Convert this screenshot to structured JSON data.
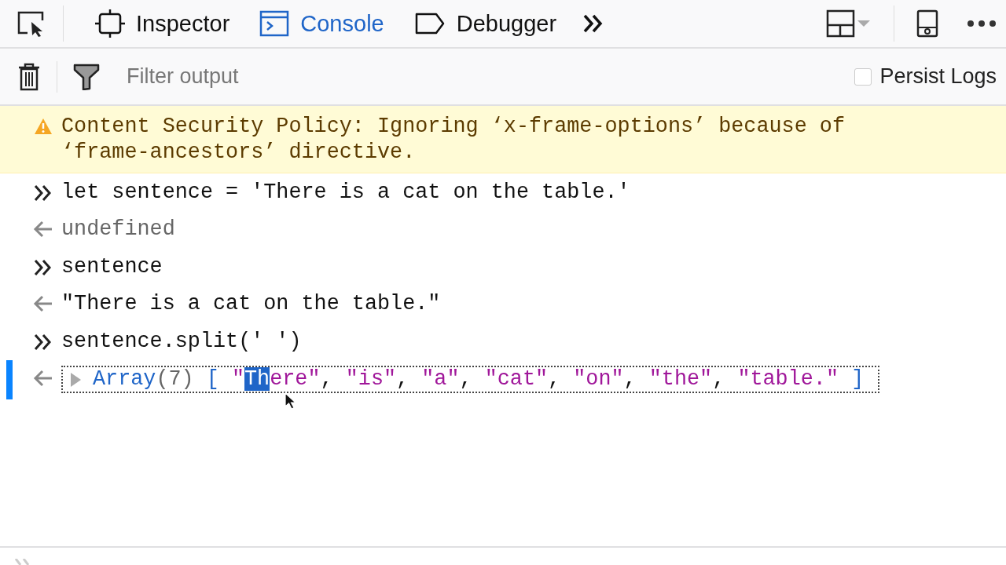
{
  "toolbar": {
    "tabs": [
      {
        "label": "Inspector",
        "selected": false
      },
      {
        "label": "Console",
        "selected": true
      },
      {
        "label": "Debugger",
        "selected": false
      }
    ]
  },
  "filter_bar": {
    "placeholder": "Filter output",
    "persist_logs": {
      "label": "Persist Logs",
      "checked": false
    }
  },
  "messages": [
    {
      "kind": "warning",
      "text": "Content Security Policy: Ignoring ‘x-frame-options’ because of ‘frame-ancestors’ directive.",
      "selected": false
    },
    {
      "kind": "input",
      "text": "let sentence = 'There is a cat on the table.'",
      "selected": false
    },
    {
      "kind": "undefined",
      "text": "undefined",
      "selected": false
    },
    {
      "kind": "input",
      "text": "sentence",
      "selected": false
    },
    {
      "kind": "result",
      "text": "\"There is a cat on the table.\"",
      "selected": false
    },
    {
      "kind": "input",
      "text": "sentence.split(' ')",
      "selected": false
    },
    {
      "kind": "array",
      "selected": true,
      "tokens": [
        {
          "text": "Array",
          "kind": "type",
          "selected": false
        },
        {
          "text": "(7)",
          "kind": "count",
          "selected": false
        },
        {
          "text": "[",
          "kind": "bracket",
          "selected": false
        },
        {
          "text": "\"",
          "kind": "string",
          "selected": false
        },
        {
          "text": "Th",
          "kind": "string",
          "selected": true
        },
        {
          "text": "ere\"",
          "kind": "string",
          "selected": false
        },
        {
          "text": ",",
          "kind": "punct",
          "selected": false
        },
        {
          "text": "\"is\"",
          "kind": "string",
          "selected": false
        },
        {
          "text": ",",
          "kind": "punct",
          "selected": false
        },
        {
          "text": "\"a\"",
          "kind": "string",
          "selected": false
        },
        {
          "text": ",",
          "kind": "punct",
          "selected": false
        },
        {
          "text": "\"cat\"",
          "kind": "string",
          "selected": false
        },
        {
          "text": ",",
          "kind": "punct",
          "selected": false
        },
        {
          "text": "\"on\"",
          "kind": "string",
          "selected": false
        },
        {
          "text": ",",
          "kind": "punct",
          "selected": false
        },
        {
          "text": "\"the\"",
          "kind": "string",
          "selected": false
        },
        {
          "text": ",",
          "kind": "punct",
          "selected": false
        },
        {
          "text": "\"table.\"",
          "kind": "string",
          "selected": false
        },
        {
          "text": "]",
          "kind": "bracket",
          "selected": false
        }
      ]
    }
  ]
}
